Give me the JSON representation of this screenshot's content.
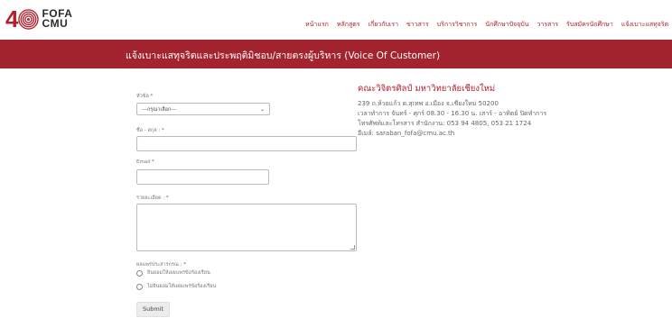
{
  "header": {
    "logo_number": "4",
    "logo_line1": "FOFA",
    "logo_line2": "CMU",
    "nav": [
      "หน้าแรก",
      "หลักสูตร",
      "เกี่ยวกับเรา",
      "ข่าวสาร",
      "บริการวิชาการ",
      "นักศึกษาปัจจุบัน",
      "วารสาร",
      "รับสมัครนักศึกษา",
      "แจ้งเบาะแสทุจริต"
    ]
  },
  "banner": {
    "title": "แจ้งเบาะแสทุจริตและประพฤติมิชอบ/สายตรงผู้บริหาร (Voice Of Customer)"
  },
  "form": {
    "subject_label": "หัวข้อ",
    "subject_placeholder": "---กรุณาเลือก---",
    "name_label": "ชื่อ - สกุล :",
    "email_label": "Email",
    "details_label": "รายละเอียด :",
    "reply_label": "ผลแพร่ประสารกรณ :",
    "reply_options": [
      "ยินยอมให้เผยแพร่ข้อร้องเรียน",
      "ไม่ยินยอมให้เผยแพร่ข้อร้องเรียน"
    ],
    "required_mark": "*",
    "submit_label": "Submit"
  },
  "contact": {
    "org_name": "คณะวิจิตรศิลป์ มหาวิทยาลัยเชียงใหม่",
    "lines": [
      "239 ถ.ห้วยแก้ว ต.สุเทพ อ.เมือง จ.เชียงใหม่ 50200",
      "เวลาทำการ จันทร์ - ศุกร์ 08.30 - 16.30 น. เสาร์ - อาทิตย์ ปิดทำการ",
      "โทรศัพท์และโทรสาร สำนักงาน: 053 94 4805, 053 21 1724",
      "อีเมล์: saraban_fofa@cmu.ac.th"
    ]
  },
  "colors": {
    "brand_red": "#a3232e",
    "accent_red": "#b1202c"
  }
}
